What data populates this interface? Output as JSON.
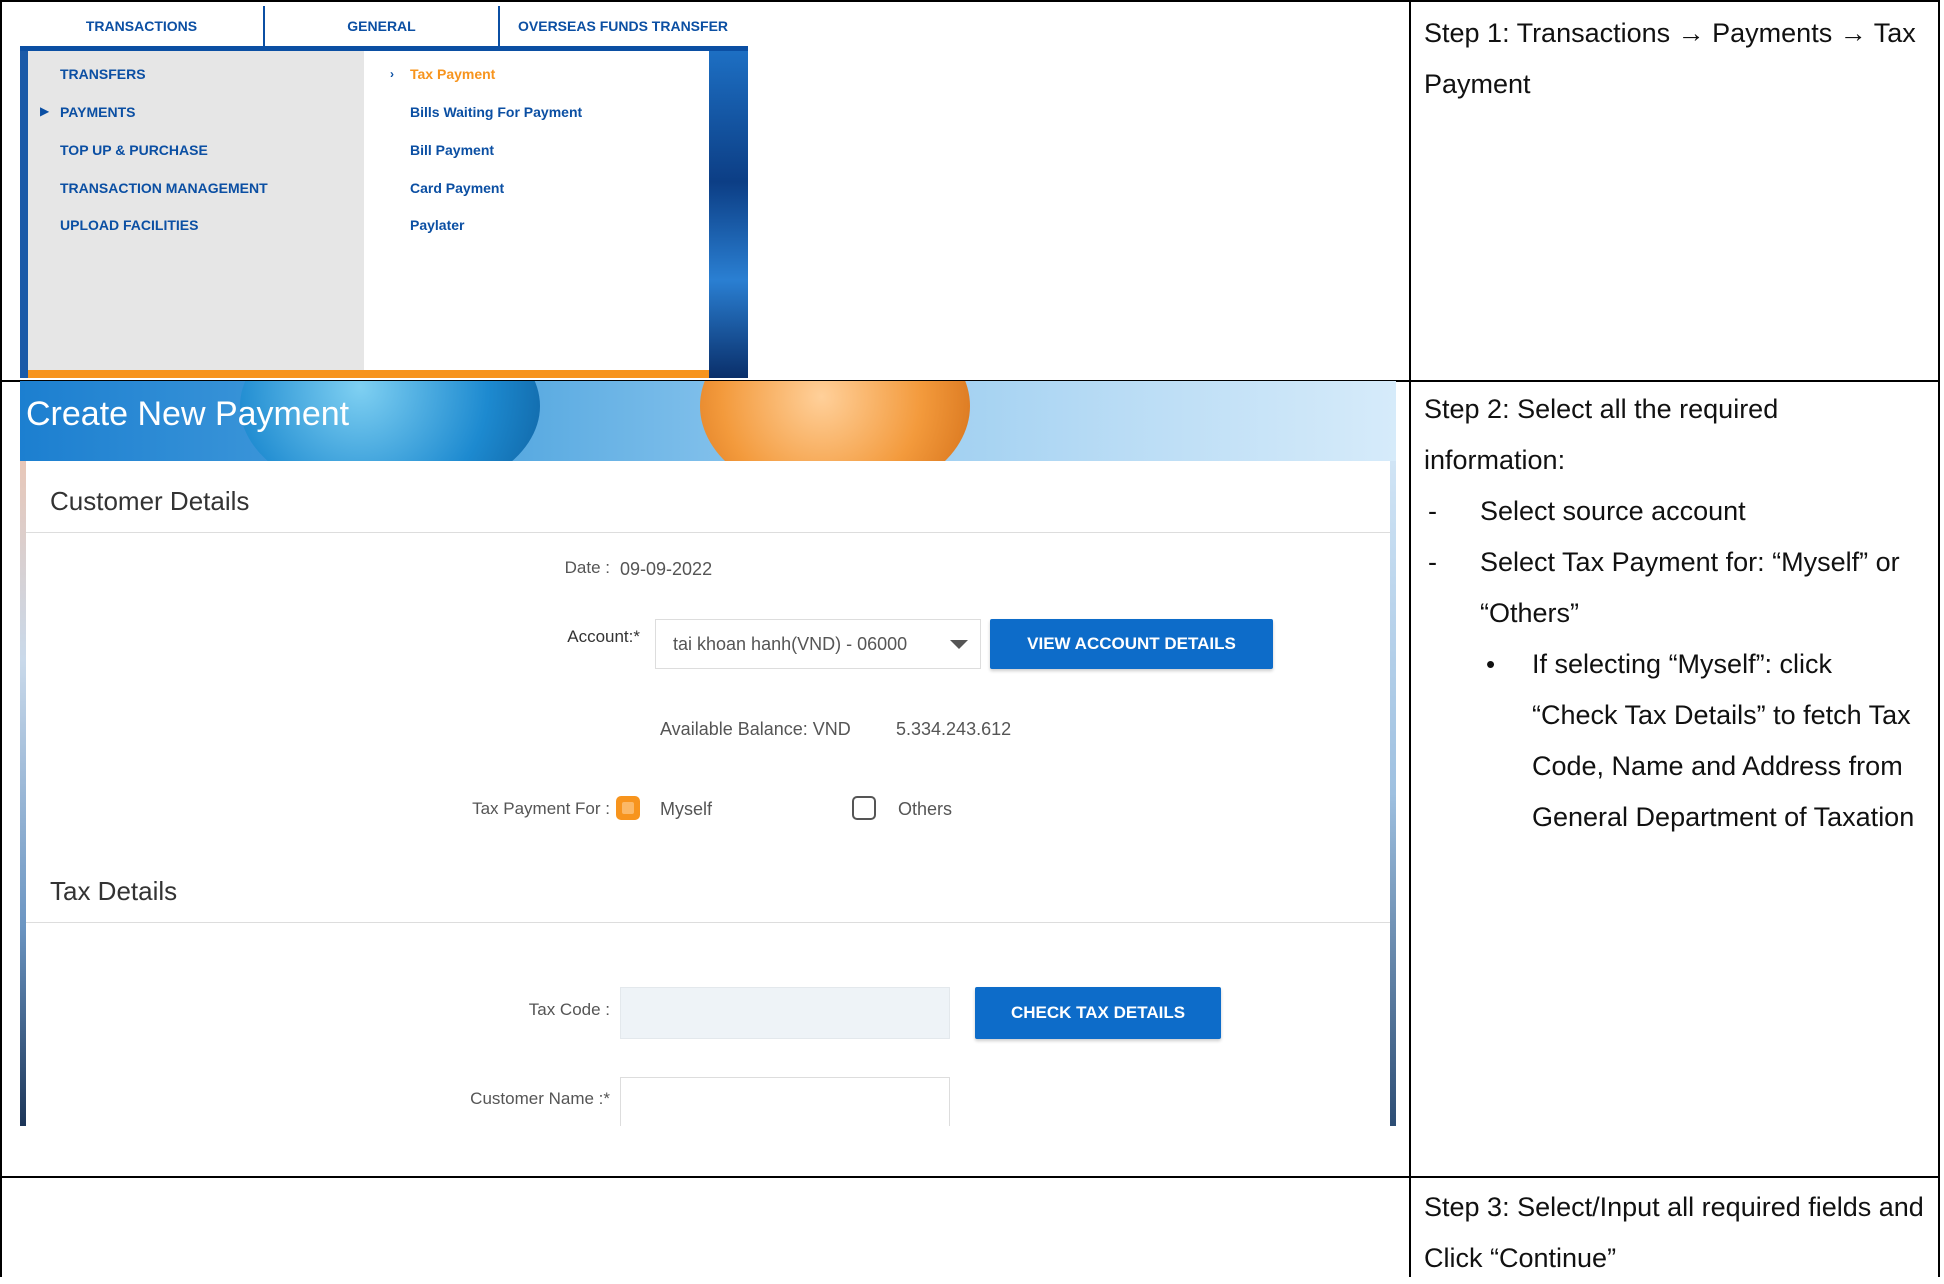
{
  "menu": {
    "tabs": [
      "TRANSACTIONS",
      "GENERAL",
      "OVERSEAS FUNDS TRANSFER"
    ],
    "left_items": [
      "TRANSFERS",
      "PAYMENTS",
      "TOP UP & PURCHASE",
      "TRANSACTION MANAGEMENT",
      "UPLOAD FACILITIES"
    ],
    "right_items": [
      "Tax Payment",
      "Bills Waiting For Payment",
      "Bill Payment",
      "Card Payment",
      "Paylater"
    ],
    "active_left": "PAYMENTS",
    "active_right": "Tax Payment"
  },
  "form": {
    "title": "Create New Payment",
    "customer_section": "Customer Details",
    "date_label": "Date :",
    "date_value": "09-09-2022",
    "account_label": "Account:*",
    "account_value": "tai khoan hanh(VND) - 06000",
    "view_account_button": "VIEW ACCOUNT DETAILS",
    "available_balance_label": "Available Balance: VND",
    "available_balance_value": "5.334.243.612",
    "tax_payment_for_label": "Tax Payment For :",
    "option_myself": "Myself",
    "option_others": "Others",
    "myself_checked": true,
    "others_checked": false,
    "tax_section": "Tax Details",
    "tax_code_label": "Tax Code :",
    "check_tax_button": "CHECK TAX DETAILS",
    "customer_name_label": "Customer Name :*"
  },
  "steps": {
    "step1": {
      "label": "Step 1",
      "text": ": Transactions → Payments → Tax Payment"
    },
    "step2": {
      "label": "Step 2",
      "text": ": Select all the required information:",
      "bullets": [
        "Select source account",
        "Select Tax Payment for: “Myself” or “Others”"
      ],
      "sub_bullets": [
        "If selecting “Myself”: click “Check Tax Details” to fetch Tax Code, Name and Address from General Department of Taxation"
      ]
    },
    "step3": {
      "label": "Step 3",
      "text": ": Select/Input all required fields and Click “Continue”"
    }
  },
  "colors": {
    "brand_blue": "#0d6cc9",
    "accent_orange": "#f7941d"
  }
}
